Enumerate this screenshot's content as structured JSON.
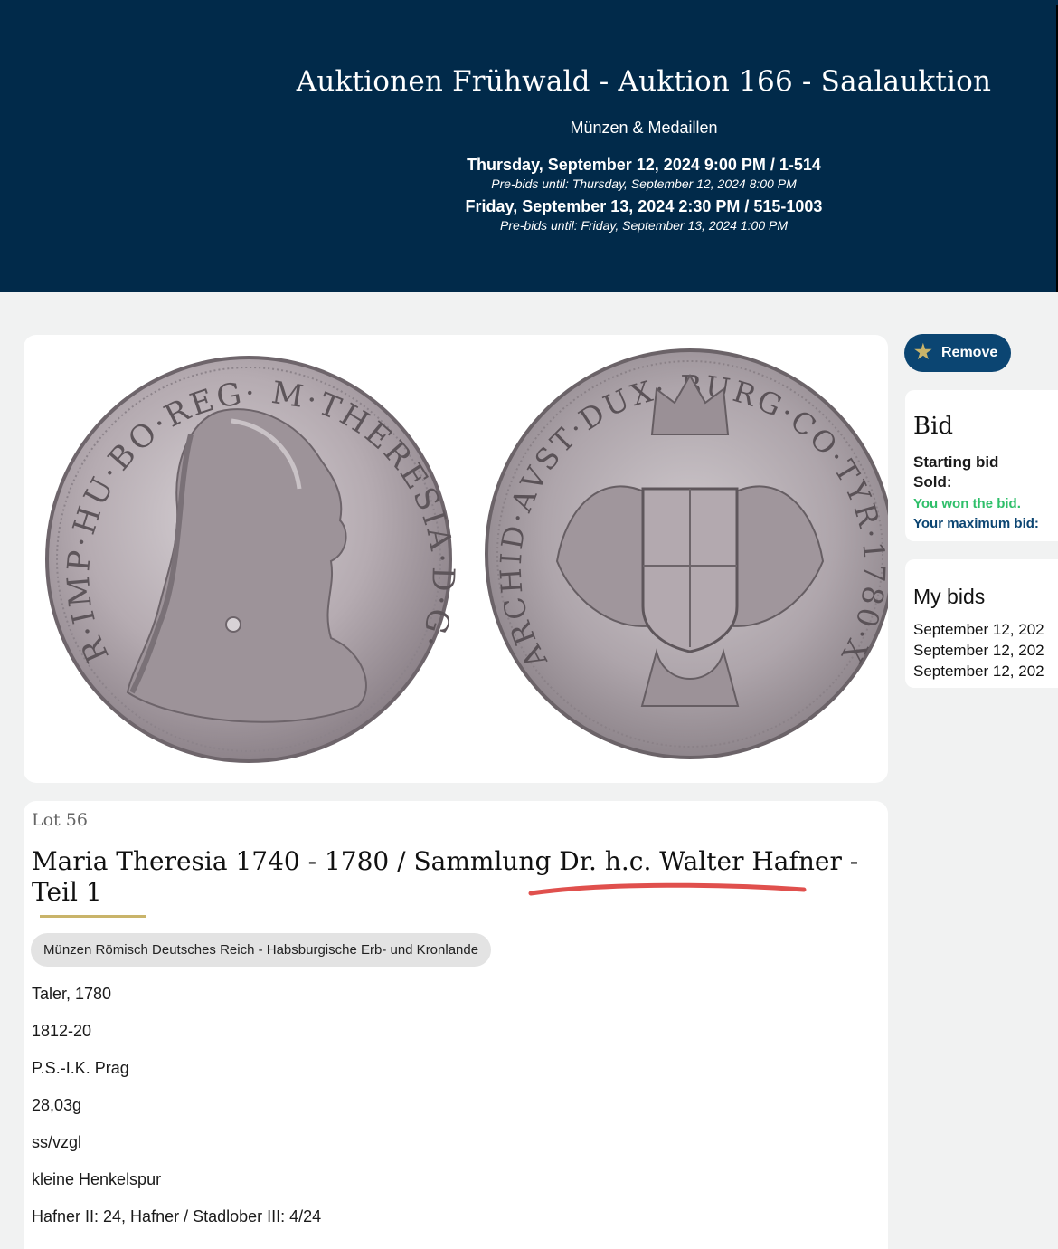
{
  "header": {
    "title": "Auktionen Frühwald - Auktion 166 - Saalauktion",
    "subtitle": "Münzen & Medaillen",
    "sessions": [
      {
        "date": "Thursday, September 12, 2024 9:00 PM / 1-514",
        "prebids": "Pre-bids until: Thursday, September 12, 2024 8:00 PM"
      },
      {
        "date": "Friday, September 13, 2024 2:30 PM / 515-1003",
        "prebids": "Pre-bids until: Friday, September 13, 2024 1:00 PM"
      }
    ]
  },
  "lot": {
    "number": "Lot 56",
    "title": "Maria Theresia 1740 - 1780 / Sammlung Dr. h.c. Walter Hafner - Teil 1",
    "category": "Münzen Römisch Deutsches Reich - Habsburgische Erb- und Kronlande",
    "details": [
      "Taler, 1780",
      "1812-20",
      "P.S.-I.K. Prag",
      "28,03g",
      "ss/vzgl",
      "kleine Henkelspur",
      "Hafner II: 24, Hafner / Stadlober III: 4/24"
    ],
    "coin_obverse_legend": "R·IMP·HU·BO·REG· M·THERESIA·D·G·",
    "coin_reverse_legend": "ARCHID·AVST·DUX· BURG·CO·TYR·1780·X·"
  },
  "watch": {
    "remove_label": "Remove",
    "icon": "star-icon"
  },
  "bid_panel": {
    "title": "Bid",
    "starting_bid": "Starting bid",
    "sold": "Sold:",
    "won": "You won the bid.",
    "max_bid": "Your maximum bid:"
  },
  "my_bids": {
    "title": "My bids",
    "entries": [
      "September 12, 202",
      "September 12, 202",
      "September 12, 202"
    ]
  },
  "colors": {
    "header_bg": "#012a4a",
    "accent_gold": "#c9b46a",
    "button_blue": "#0b4572",
    "won_green": "#2fbf6a",
    "annotation_red": "#e0504d"
  }
}
